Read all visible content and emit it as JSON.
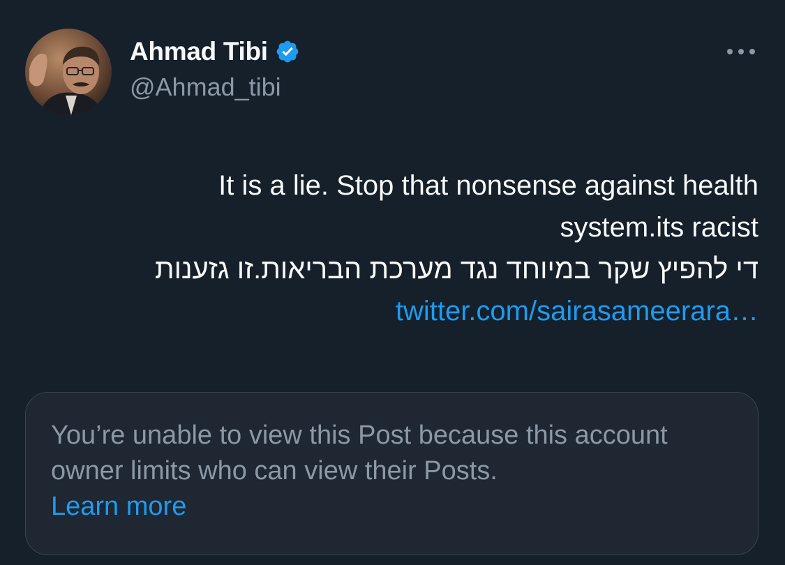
{
  "author": {
    "display_name": "Ahmad Tibi",
    "handle": "@Ahmad_tibi",
    "verified": true,
    "avatar_icon": "profile-photo"
  },
  "header": {
    "more_icon": "more-horizontal-icon"
  },
  "post": {
    "line1": "It is a lie. Stop that nonsense against health",
    "line2": "system.its racist",
    "line3": "די להפיץ שקר במיוחד נגד מערכת הבריאות.זו גזענות",
    "link_text": "twitter.com/sairasameerara…"
  },
  "quoted_notice": {
    "message": "You’re unable to view this Post because this account owner limits who can view their Posts.",
    "learn_more": "Learn more"
  },
  "colors": {
    "background": "#15202b",
    "accent": "#1d9bf0",
    "muted": "#8b98a5",
    "text": "#f7f9f9",
    "border": "#38444d"
  }
}
